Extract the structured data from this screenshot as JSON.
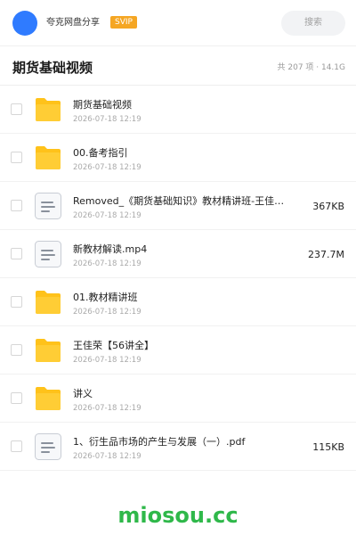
{
  "topbar": {
    "user_name": "夸克网盘分享",
    "vip_label": "SVIP",
    "search_label": "搜索"
  },
  "header": {
    "title": "期货基础视频",
    "stats": "共 207 项 · 14.1G"
  },
  "files": [
    {
      "type": "folder",
      "name": "期货基础视频",
      "date": "2026-07-18 12:19",
      "size": ""
    },
    {
      "type": "folder",
      "name": "00.备考指引",
      "date": "2026-07-18 12:19",
      "size": ""
    },
    {
      "type": "file",
      "name": "Removed_《期货基础知识》教材精讲班-王佳荣…",
      "date": "2026-07-18 12:19",
      "size": "367KB"
    },
    {
      "type": "file",
      "name": "新教材解读.mp4",
      "date": "2026-07-18 12:19",
      "size": "237.7M"
    },
    {
      "type": "folder",
      "name": "01.教材精讲班",
      "date": "2026-07-18 12:19",
      "size": ""
    },
    {
      "type": "folder",
      "name": "王佳荣【56讲全】",
      "date": "2026-07-18 12:19",
      "size": ""
    },
    {
      "type": "folder",
      "name": "讲义",
      "date": "2026-07-18 12:19",
      "size": ""
    },
    {
      "type": "file",
      "name": "1、衍生品市场的产生与发展（一）.pdf",
      "date": "2026-07-18 12:19",
      "size": "115KB"
    }
  ],
  "icons": {
    "folder": "folder-icon",
    "file": "document-icon"
  },
  "colors": {
    "accent": "#2f7bff",
    "vip": "#f5a623",
    "folder": "#ffc21a",
    "watermark": "#2fb84a"
  },
  "watermark": "miosou.cc"
}
